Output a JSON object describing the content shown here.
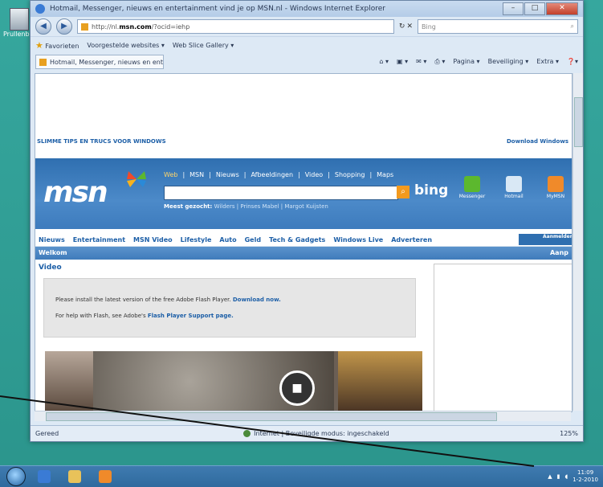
{
  "desktop": {
    "icon_label": "Prullenbak"
  },
  "window": {
    "title": "Hotmail, Messenger, nieuws en entertainment vind je op MSN.nl - Windows Internet Explorer",
    "min_label": "–",
    "max_label": "□",
    "close_label": "✕"
  },
  "nav": {
    "back": "◀",
    "forward": "▶",
    "address_prefix": "http://nl.",
    "address_host": "msn.com",
    "address_suffix": "/?ocid=iehp",
    "refresh": "↻",
    "stop": "✕",
    "search_placeholder": "Bing",
    "search_btn": "⌕"
  },
  "favbar": {
    "favorites": "Favorieten",
    "suggested": "Voorgestelde websites ▾",
    "gallery": "Web Slice Gallery ▾"
  },
  "tab": {
    "label": "Hotmail, Messenger, nieuws en enterta..."
  },
  "cmd": {
    "home": "⌂ ▾",
    "feeds": "▣ ▾",
    "mail": "✉ ▾",
    "print": "⎙ ▾",
    "page": "Pagina ▾",
    "safety": "Beveiliging ▾",
    "tools": "Extra ▾",
    "help": "❓▾"
  },
  "page": {
    "tips_left": "SLIMME TIPS EN TRUCS VOOR WINDOWS",
    "tips_right": "Download Windows",
    "logo": "msn",
    "links": [
      "Web",
      "MSN",
      "Nieuws",
      "Afbeeldingen",
      "Video",
      "Shopping",
      "Maps"
    ],
    "search_go": "⌕",
    "bing": "bing",
    "popular_label": "Meest gezocht:",
    "popular_items": "Wilders | Prinses Mabel | Margot Kuijsten",
    "apps": [
      "Messenger",
      "Hotmail",
      "MyMSN"
    ],
    "categories": [
      "Nieuws",
      "Entertainment",
      "MSN Video",
      "Lifestyle",
      "Auto",
      "Geld",
      "Tech & Gadgets",
      "Windows Live",
      "Adverteren"
    ],
    "cat_right": "Aanmelden",
    "welcome": "Welkom",
    "welcome_right": "Aanp",
    "video_heading": "Video",
    "flash_text1": "Please install the latest version of the free Adobe Flash Player.",
    "flash_link1": "Download now.",
    "flash_text2": "For help with Flash, see Adobe's",
    "flash_link2": "Flash Player Support page."
  },
  "status": {
    "left": "Gereed",
    "zone": "Internet | Beveiligde modus: ingeschakeld",
    "zoom": "125%"
  },
  "taskbar": {
    "clock_time": "11:09",
    "clock_date": "1-2-2010"
  },
  "colors": {
    "msn_blue": "#2f6fb0",
    "bing_orange": "#f39a1e",
    "desktop": "#2a9a92"
  }
}
